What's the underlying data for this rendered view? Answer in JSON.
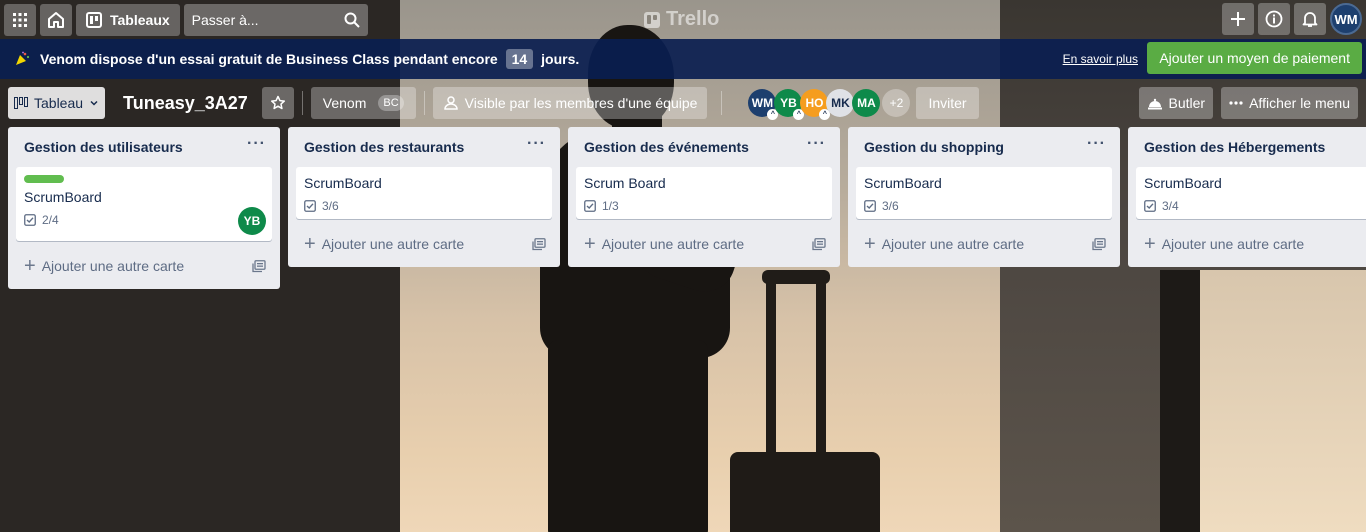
{
  "topnav": {
    "apps_icon": "apps-grid-icon",
    "home_icon": "home-icon",
    "boards_label": "Tableaux",
    "search_placeholder": "Passer à...",
    "logo_text": "Trello",
    "user_initials": "WM"
  },
  "banner": {
    "text": "Venom dispose d'un essai gratuit de Business Class pendant encore",
    "days": "14",
    "days_suffix": "jours.",
    "learn_more": "En savoir plus",
    "cta": "Ajouter un moyen de paiement"
  },
  "board": {
    "view_label": "Tableau",
    "title": "Tuneasy_3A27",
    "workspace": "Venom",
    "workspace_badge": "BC",
    "visibility": "Visible par les membres d'une équipe",
    "members": [
      {
        "initials": "WM",
        "color": "#1d3f6e"
      },
      {
        "initials": "YB",
        "color": "#0e8a4a"
      },
      {
        "initials": "HO",
        "color": "#f59d1f"
      },
      {
        "initials": "MK",
        "color": "#dfe1e6"
      },
      {
        "initials": "MA",
        "color": "#0e8a4a"
      }
    ],
    "members_more": "+2",
    "invite": "Inviter",
    "butler": "Butler",
    "menu": "Afficher le menu"
  },
  "lists": [
    {
      "title": "Gestion des utilisateurs",
      "card": "ScrumBoard",
      "checklist": "2/4",
      "avatar": "YB",
      "add": "Ajouter une autre carte"
    },
    {
      "title": "Gestion des restaurants",
      "card": "ScrumBoard",
      "checklist": "3/6",
      "add": "Ajouter une autre carte"
    },
    {
      "title": "Gestion des événements",
      "card": "Scrum Board",
      "checklist": "1/3",
      "add": "Ajouter une autre carte"
    },
    {
      "title": "Gestion du shopping",
      "card": "ScrumBoard",
      "checklist": "3/6",
      "add": "Ajouter une autre carte"
    },
    {
      "title": "Gestion des Hébergements",
      "card": "ScrumBoard",
      "checklist": "3/4",
      "add": "Ajouter une autre carte"
    }
  ]
}
